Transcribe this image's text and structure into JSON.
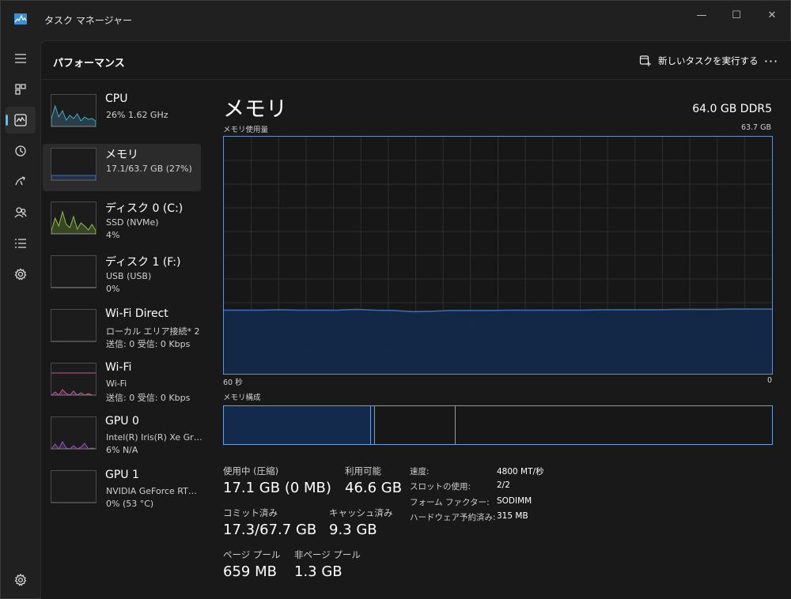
{
  "window": {
    "title": "タスク マネージャー",
    "controls": {
      "minimize": "—",
      "maximize": "☐",
      "close": "✕"
    }
  },
  "nav_rail": {
    "items": [
      {
        "name": "menu-icon",
        "active": false
      },
      {
        "name": "processes-icon",
        "active": false
      },
      {
        "name": "performance-icon",
        "active": true
      },
      {
        "name": "app-history-icon",
        "active": false
      },
      {
        "name": "startup-apps-icon",
        "active": false
      },
      {
        "name": "users-icon",
        "active": false
      },
      {
        "name": "details-icon",
        "active": false
      },
      {
        "name": "services-icon",
        "active": false
      },
      {
        "name": "settings-icon",
        "active": false
      }
    ]
  },
  "header": {
    "title": "パフォーマンス",
    "new_task_label": "新しいタスクを実行する",
    "more_label": "···"
  },
  "devices": [
    {
      "name": "CPU",
      "sub1": "26%  1.62 GHz",
      "sub2": "",
      "color": "#4aa8c8",
      "selected": false
    },
    {
      "name": "メモリ",
      "sub1": "17.1/63.7 GB (27%)",
      "sub2": "",
      "color": "#3d6fb8",
      "selected": true
    },
    {
      "name": "ディスク 0 (C:)",
      "sub1": "SSD (NVMe)",
      "sub2": "4%",
      "color": "#8cc23e",
      "selected": false
    },
    {
      "name": "ディスク 1 (F:)",
      "sub1": "USB (USB)",
      "sub2": "0%",
      "color": "#8cc23e",
      "selected": false
    },
    {
      "name": "Wi-Fi Direct",
      "sub1": "ローカル エリア接続* 2",
      "sub2": "送信: 0  受信: 0 Kbps",
      "color": "#c9559b",
      "selected": false
    },
    {
      "name": "Wi-Fi",
      "sub1": "Wi-Fi",
      "sub2": "送信: 0  受信: 0 Kbps",
      "color": "#c9559b",
      "selected": false
    },
    {
      "name": "GPU 0",
      "sub1": "Intel(R) Iris(R) Xe Grap...",
      "sub2": "6%  N/A",
      "color": "#a24fc4",
      "selected": false
    },
    {
      "name": "GPU 1",
      "sub1": "NVIDIA GeForce RTX ...",
      "sub2": "0%  (53 °C)",
      "color": "#a24fc4",
      "selected": false
    }
  ],
  "memory": {
    "title": "メモリ",
    "subtitle": "64.0 GB DDR5",
    "graph_label": "メモリ使用量",
    "graph_max_label": "63.7 GB",
    "axis_left": "60 秒",
    "axis_right": "0",
    "composition_label": "メモリ構成",
    "accent_color": "#3d6fb8",
    "stats": {
      "in_use_label": "使用中 (圧縮)",
      "in_use_value": "17.1 GB (0 MB)",
      "available_label": "利用可能",
      "available_value": "46.6 GB",
      "committed_label": "コミット済み",
      "committed_value": "17.3/67.7 GB",
      "cached_label": "キャッシュ済み",
      "cached_value": "9.3 GB",
      "paged_label": "ページ プール",
      "paged_value": "659 MB",
      "nonpaged_label": "非ページ プール",
      "nonpaged_value": "1.3 GB"
    },
    "specs": [
      {
        "key": "速度:",
        "value": "4800 MT/秒"
      },
      {
        "key": "スロットの使用:",
        "value": "2/2"
      },
      {
        "key": "フォーム ファクター:",
        "value": "SODIMM"
      },
      {
        "key": "ハードウェア予約済み:",
        "value": "315 MB"
      }
    ]
  },
  "chart_data": {
    "type": "area",
    "title": "メモリ使用量",
    "xlabel": "",
    "ylabel": "",
    "x_range_label": [
      "60 秒",
      "0"
    ],
    "ylim": [
      0,
      63.7
    ],
    "grid": true,
    "series": [
      {
        "values": [
          17.1,
          17.1,
          17.1,
          17.2,
          17.1,
          17.1,
          17.1,
          17.3,
          17.1,
          17.0,
          16.7,
          16.8,
          17.0,
          17.0,
          17.0,
          17.1,
          17.1,
          17.1,
          17.1,
          17.1,
          17.2,
          17.2,
          17.2,
          17.2,
          17.3,
          17.3,
          17.3,
          17.4,
          17.4,
          17.4
        ]
      }
    ],
    "composition": {
      "in_use_gb": 17.1,
      "modified_gb": 0.5,
      "standby_gb": 9.3,
      "free_gb": 36.8,
      "total_gb": 63.7
    }
  }
}
